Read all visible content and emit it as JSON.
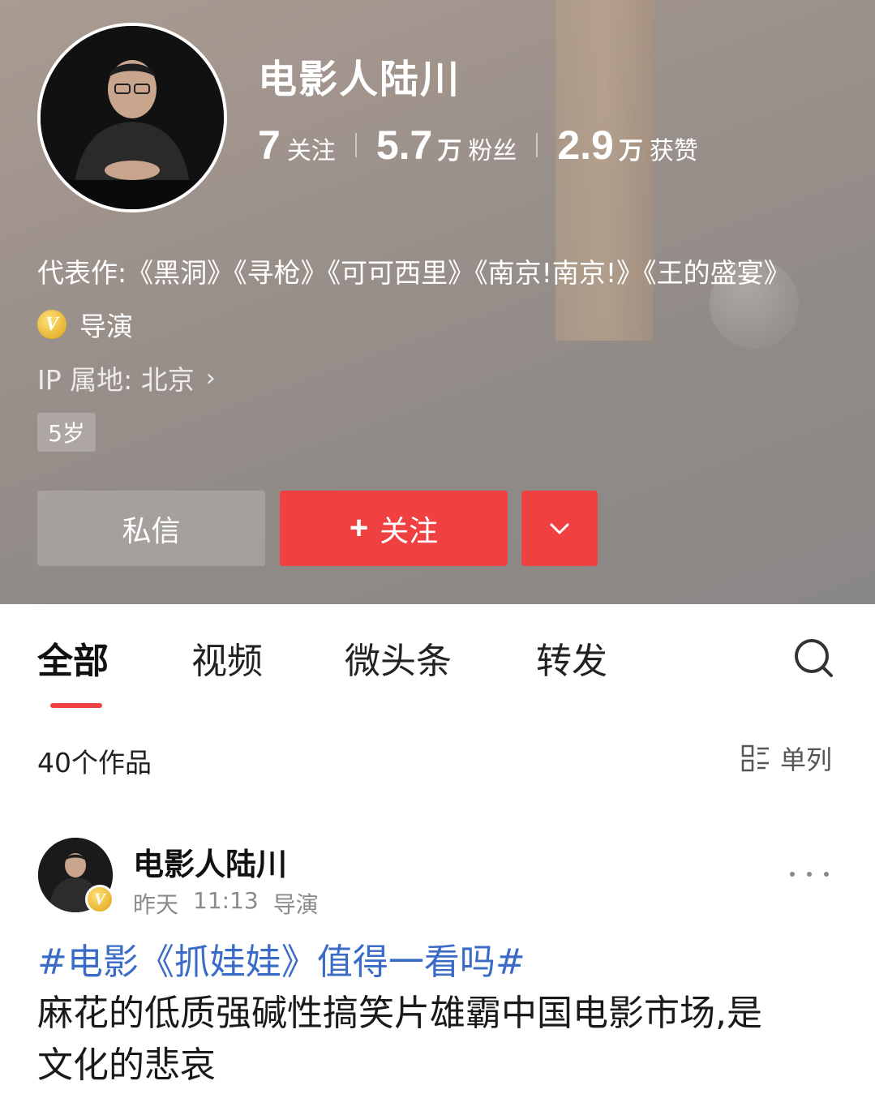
{
  "profile": {
    "name": "电影人陆川",
    "stats": [
      {
        "num": "7",
        "unit": "",
        "label": "关注"
      },
      {
        "num": "5.7",
        "unit": "万",
        "label": "粉丝"
      },
      {
        "num": "2.9",
        "unit": "万",
        "label": "获赞"
      }
    ],
    "works": "代表作:《黑洞》《寻枪》《可可西里》《南京!南京!》《王的盛宴》",
    "verify_badge": "V",
    "verify_text": "导演",
    "ip_location": "IP 属地: 北京",
    "ip_chevron": "›",
    "age_tag": "5岁",
    "buttons": {
      "message": "私信",
      "follow_plus": "+",
      "follow": "关注"
    }
  },
  "tabs": [
    "全部",
    "视频",
    "微头条",
    "转发"
  ],
  "active_tab": "全部",
  "works_count": "40个作品",
  "view_toggle": "单列",
  "post": {
    "author": "电影人陆川",
    "verify_badge": "V",
    "time": "昨天",
    "clock": "11:13",
    "role": "导演",
    "topic": "#电影《抓娃娃》值得一看吗#",
    "body": "麻花的低质强碱性搞笑片雄霸中国电影市场,是文化的悲哀"
  },
  "colors": {
    "accent": "#f04142",
    "link": "#3a6cc7",
    "verified_gold": "#e6b12d"
  },
  "icons": [
    "chevron-down-icon",
    "search-icon",
    "list-view-icon",
    "more-dots-icon",
    "verified-v-icon",
    "chevron-right-icon"
  ]
}
